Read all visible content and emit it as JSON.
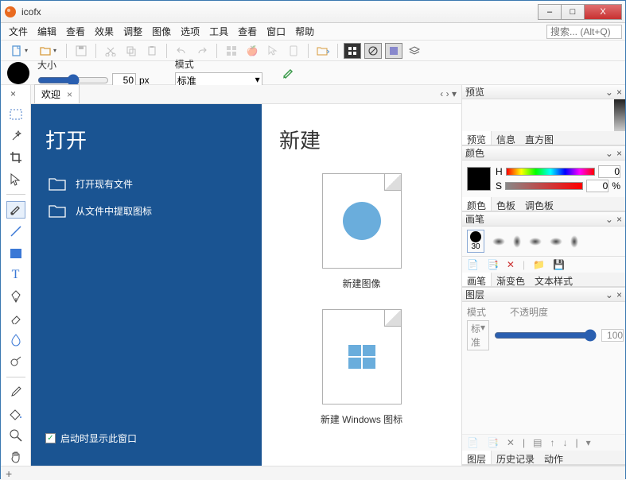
{
  "app": {
    "title": "icofx"
  },
  "window_buttons": {
    "min": "–",
    "max": "□",
    "close": "X"
  },
  "menu": {
    "items": [
      "文件",
      "编辑",
      "查看",
      "效果",
      "调整",
      "图像",
      "选项",
      "工具",
      "查看",
      "窗口",
      "帮助"
    ],
    "search_placeholder": "搜索... (Alt+Q)"
  },
  "toolbar": {
    "new_dd": "▾",
    "open_dd": "▾"
  },
  "brush_bar": {
    "size_label": "大小",
    "size_value": "50",
    "size_unit": "px",
    "mode_label": "模式",
    "mode_value": "标准",
    "mode_dd": "▾"
  },
  "tab": {
    "welcome_label": "欢迎",
    "close": "×",
    "nav_prev": "‹",
    "nav_next": "›",
    "nav_dd": "▾",
    "strip_close": "×"
  },
  "welcome": {
    "open_heading": "打开",
    "open_items": [
      "打开现有文件",
      "从文件中提取图标"
    ],
    "new_heading": "新建",
    "new_image_label": "新建图像",
    "new_win_icon_label": "新建 Windows 图标",
    "startup_label": "启动时显示此窗口"
  },
  "panels": {
    "preview": {
      "title": "预览",
      "tabs": [
        "预览",
        "信息",
        "直方图"
      ]
    },
    "color": {
      "title": "颜色",
      "tabs": [
        "颜色",
        "色板",
        "调色板"
      ],
      "h_label": "H",
      "s_label": "S",
      "h_val": "0",
      "s_val": "0",
      "s_unit": "%"
    },
    "brush": {
      "title": "画笔",
      "tabs": [
        "画笔",
        "渐变色",
        "文本样式"
      ],
      "size_label": "30"
    },
    "layer": {
      "title": "图层",
      "mode_label": "模式",
      "opacity_label": "不透明度",
      "mode_value": "标准",
      "opacity_value": "100",
      "opacity_unit": "%",
      "tabs": [
        "图层",
        "历史记录",
        "动作"
      ]
    }
  },
  "footer": {
    "plus": "+"
  }
}
